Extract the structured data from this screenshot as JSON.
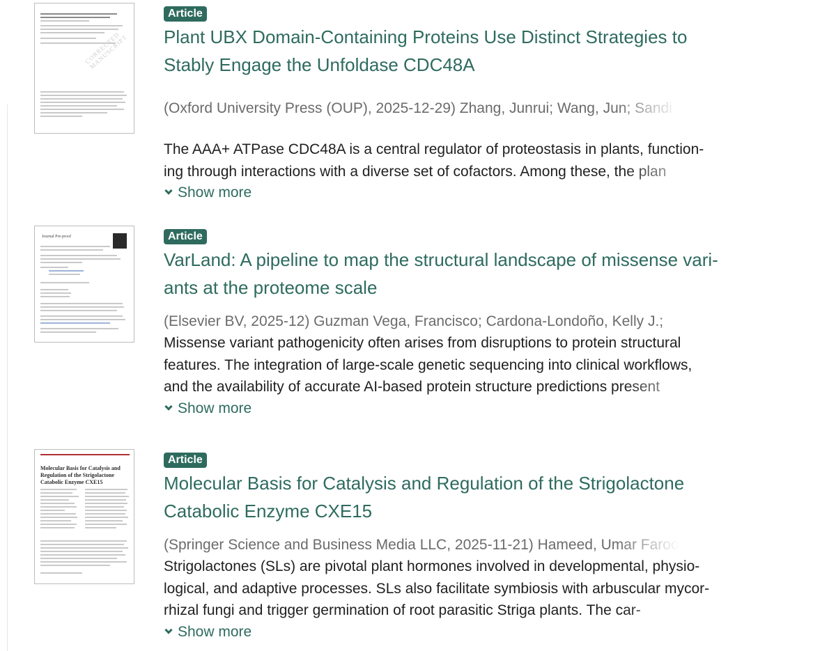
{
  "results": [
    {
      "badge": "Article",
      "title_lines": [
        "Plant UBX Domain-Containing Proteins Use Distinct Strategies to",
        "Stably Engage the Unfoldase CDC48A"
      ],
      "meta": "(Oxford University Press (OUP), 2025-12-29) Zhang, Junrui; Wang, Jun; Sandi",
      "abstract_lines": [
        "The AAA+ ATPase CDC48A is a central regulator of proteostasis in plants, function-",
        "ing through interactions with a diverse set of cofactors. Among these, the plan"
      ],
      "show_more": "Show more"
    },
    {
      "badge": "Article",
      "title_lines": [
        "VarLand: A pipeline to map the structural landscape of missense vari-",
        "ants at the proteome scale"
      ],
      "meta": "(Elsevier BV, 2025-12) Guzman Vega, Francisco; Cardona-Londoño, Kelly J.;",
      "abstract_lines": [
        "Missense variant pathogenicity often arises from disruptions to protein structural",
        "features. The integration of large-scale genetic sequencing into clinical workflows,",
        "and the availability of accurate AI-based protein structure predictions present"
      ],
      "show_more": "Show more"
    },
    {
      "badge": "Article",
      "title_lines": [
        "Molecular Basis for Catalysis and Regulation of the Strigolactone",
        "Catabolic Enzyme CXE15"
      ],
      "meta": "(Springer Science and Business Media LLC, 2025-11-21) Hameed, Umar Faroo",
      "abstract_lines": [
        "Strigolactones (SLs) are pivotal plant hormones involved in developmental, physio-",
        "logical, and adaptive processes. SLs also facilitate symbiosis with arbuscular mycor-",
        "rhizal fungi and trigger germination of root parasitic Striga plants. The car-"
      ],
      "show_more": "Show more"
    }
  ],
  "thumbnails": {
    "r1_stamp": "CORRECTED MANUSCRIPT",
    "r2_header": "Journal Pre-proof",
    "r3_title": "Molecular Basis for Catalysis and Regulation of the Strigolactone Catabolic Enzyme CXE15"
  },
  "colors": {
    "accent": "#2e6b5e",
    "meta_text": "#6b6b6b",
    "body_text": "#1f1f1f"
  },
  "icons": {
    "show_more": "chevron-down-icon"
  }
}
